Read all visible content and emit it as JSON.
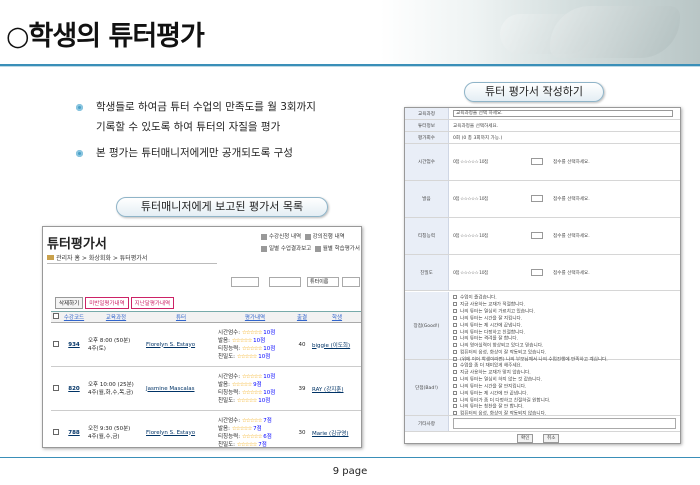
{
  "slide": {
    "title": "○학생의 튜터평가",
    "bullets": [
      "학생들로 하여금 튜터 수업의 만족도를 월 3회까지",
      "기록할 수 있도록 하여 튜터의 자질을 평가",
      "본 평가는 튜터매니저에게만 공개되도록 구성"
    ],
    "left_caption": "튜터매니저에게 보고된 평가서 목록",
    "right_caption": "튜터 평가서 작성하기",
    "page_label": "9 page"
  },
  "list_window": {
    "title": "튜터평가서",
    "breadcrumb": "관리자 홈 > 화상회화 > 튜터평가서",
    "menu_links": [
      "수강신청 내역",
      "강의진행 내역",
      "일별 수업결과보고",
      "월별 학습평가서"
    ],
    "filter_select": "튜터이름",
    "buttons": [
      "삭제하기",
      "미반일평가내역",
      "지난달평가내역"
    ],
    "columns": [
      "",
      "수강코드",
      "교육과정",
      "튜터",
      "평가내역",
      "출결",
      "학생"
    ],
    "rows": [
      {
        "code": "934",
        "course": "오후 8:00 (50분)\n4주(토)",
        "tutor": "Florelyn S. Estayo",
        "points": [
          "10점",
          "10점",
          "10점",
          "10점"
        ],
        "attendance": "40",
        "student": "biggie (이도희)"
      },
      {
        "code": "820",
        "course": "오후 10:00 (25분)\n4주(월,화,수,목,금)",
        "tutor": "Jasmine Mascalas",
        "points": [
          "10점",
          "9점",
          "10점",
          "10점"
        ],
        "attendance": "39",
        "student": "RAY (강지훈)"
      },
      {
        "code": "788",
        "course": "오전 9:30 (50분)\n4주(월,수,금)",
        "tutor": "Florelyn S. Estayo",
        "points": [
          "7점",
          "7점",
          "6점",
          "7점"
        ],
        "attendance": "30",
        "student": "Marie (김규영)"
      }
    ],
    "eval_labels": [
      "시간엄수:",
      "발음:",
      "티칭능력:",
      "친밀도:"
    ],
    "stars": "☆☆☆☆☆"
  },
  "form_window": {
    "labels": [
      "교육과정",
      "튜터정보",
      "평가회수",
      "시간엄수",
      "발음",
      "티칭능력",
      "친밀도",
      "장점(Good!)",
      "단점(Bad!)",
      "기타사항"
    ],
    "course_select": "교육과정을 선택 하세요.",
    "tutor_info": "교육과정을 선택하세요.",
    "eval_count": "0회 (0 총 3회까지 가능.)",
    "score_row": "0점 ☆☆☆☆☆ 10점",
    "reason_select": "점수를 선택하세요.",
    "good_items": [
      "수업이 즐겁습니다.",
      "지금 사용하는 교재가 적절합니다.",
      "나의 튜터는 열심히 가르치고 있습니다.",
      "나의 튜터는 시간을 잘 지킵니다.",
      "나의 튜터는 제 시간에 끝냅니다.",
      "나의 튜터는 다정하고 친절합니다.",
      "나의 튜터는 격려를 잘 합니다.",
      "나의 영어실력이 향상되고 있다고 믿습니다.",
      "컴퓨터의 음성, 화상이 잘 작동되고 있습니다.",
      "(위에 이어 학생이라면) 나의 부모님께서 나의 수업진행에 만족하고 계십니다."
    ],
    "bad_items": [
      "수업을 좀 더 재미있게 해주세요.",
      "지금 사용하는 교재가 맞지 않습니다.",
      "나의 튜터는 열심히 하지 않는 것 같습니다.",
      "나의 튜터는 시간을 잘 안지킵니다.",
      "나의 튜터는 제 시간에 안 끝냅니다.",
      "나의 튜터가 좀 더 다정하고 친절하길 원합니다.",
      "나의 튜터는 칭찬을 잘 안 합니다.",
      "컴퓨터의 음성, 화상이 잘 작동되지 않습니다."
    ],
    "confirm_button": "확인",
    "cancel_button": "취소"
  }
}
